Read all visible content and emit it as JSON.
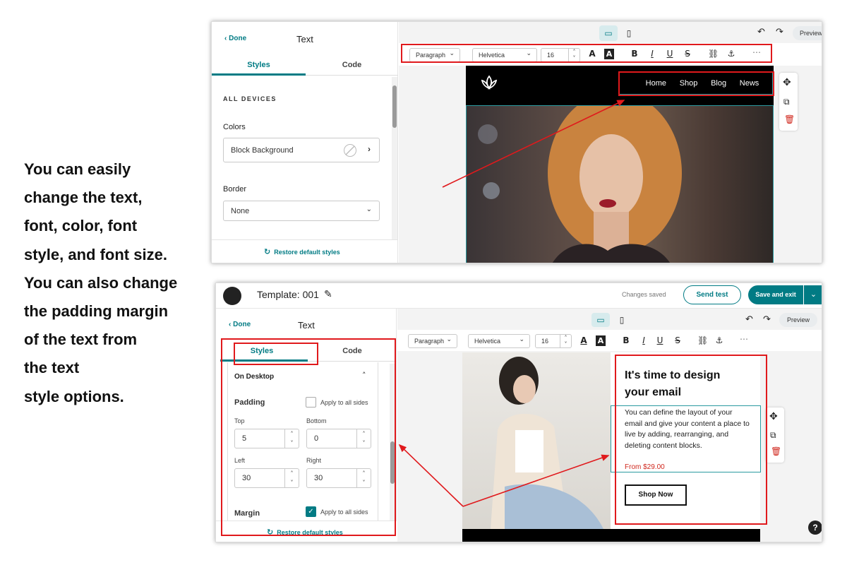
{
  "description": {
    "lines": [
      "You can easily",
      "change the text,",
      "font, color, font",
      "style, and font size.",
      "You can also change",
      "the padding margin",
      "of the text from",
      "the text",
      "style options."
    ]
  },
  "top": {
    "done": "Done",
    "title": "Text",
    "tabs": {
      "styles": "Styles",
      "code": "Code"
    },
    "preview": "Preview",
    "section": "ALL DEVICES",
    "colors_label": "Colors",
    "block_background": "Block Background",
    "border_label": "Border",
    "border_value": "None",
    "restore": "Restore default styles",
    "toolbar": {
      "block_type": "Paragraph",
      "font": "Helvetica",
      "size": "16"
    },
    "nav": [
      "Home",
      "Shop",
      "Blog",
      "News"
    ]
  },
  "bottom": {
    "template_title": "Template: 001",
    "changes_saved": "Changes saved",
    "send_test": "Send test",
    "save_exit": "Save and exit",
    "preview": "Preview",
    "done": "Done",
    "title": "Text",
    "tabs": {
      "styles": "Styles",
      "code": "Code"
    },
    "toolbar": {
      "block_type": "Paragraph",
      "font": "Helvetica",
      "size": "16"
    },
    "on_desktop": "On Desktop",
    "padding_label": "Padding",
    "apply_all": "Apply to all sides",
    "top_label": "Top",
    "top_value": "5",
    "bottom_label": "Bottom",
    "bottom_value": "0",
    "left_label": "Left",
    "left_value": "30",
    "right_label": "Right",
    "right_value": "30",
    "margin_label": "Margin",
    "margin_apply_all": "Apply to all sides",
    "restore": "Restore default styles",
    "headline": "It's time to design your email",
    "body": "You can define the layout of your email and give your content a place to live by adding, rearranging, and deleting content blocks.",
    "price": "From $29.00",
    "shop_now": "Shop Now"
  },
  "colors": {
    "accent": "#017b84",
    "highlight": "#e0191c",
    "price": "#d0271d"
  }
}
